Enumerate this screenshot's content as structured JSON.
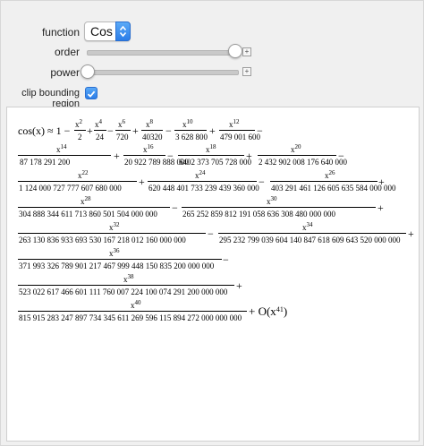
{
  "controls": {
    "function_label": "function",
    "function_value": "Cos",
    "order_label": "order",
    "power_label": "power",
    "clip_label": "clip bounding region",
    "clip_checked": true,
    "order_level": 0.98,
    "power_level": 0.0
  },
  "colors": {
    "accent": "#2b7de8"
  },
  "series": {
    "lhs": "cos(x) ≈ 1 −",
    "t2_num": "x",
    "t2_exp": "2",
    "t2_den": "2",
    "t4_num": "x",
    "t4_exp": "4",
    "t4_den": "24",
    "t6_num": "x",
    "t6_exp": "6",
    "t6_den": "720",
    "t8_num": "x",
    "t8_exp": "8",
    "t8_den": "40320",
    "t10_num": "x",
    "t10_exp": "10",
    "t10_den": "3 628 800",
    "t12_num": "x",
    "t12_exp": "12",
    "t12_den": "479 001 600",
    "t14_exp": "14",
    "t14_den": "87 178 291 200",
    "t16_exp": "16",
    "t16_den": "20 922 789 888 000",
    "t18_exp": "18",
    "t18_den": "6402 373 705 728 000",
    "t20_exp": "20",
    "t20_den": "2 432 902 008 176 640 000",
    "t22_exp": "22",
    "t22_den": "1 124 000 727 777 607 680 000",
    "t24_exp": "24",
    "t24_den": "620 448 401 733 239 439 360 000",
    "t26_exp": "26",
    "t26_den": "403 291 461 126 605 635 584 000 000",
    "t28_exp": "28",
    "t28_den": "304 888 344 611 713 860 501 504 000 000",
    "t30_exp": "30",
    "t30_den": "265 252 859 812 191 058 636 308 480 000 000",
    "t32_exp": "32",
    "t32_den": "263 130 836 933 693 530 167 218 012 160 000 000",
    "t34_exp": "34",
    "t34_den": "295 232 799 039 604 140 847 618 609 643 520 000 000",
    "t36_exp": "36",
    "t36_den": "371 993 326 789 901 217 467 999 448 150 835 200 000 000",
    "t38_exp": "38",
    "t38_den": "523 022 617 466 601 111 760 007 224 100 074 291 200 000 000",
    "t40_exp": "40",
    "t40_den": "815 915 283 247 897 734 345 611 269 596 115 894 272 000 000 000",
    "tail": "+ O(x",
    "tail_exp": "41",
    "tail_close": ")"
  }
}
